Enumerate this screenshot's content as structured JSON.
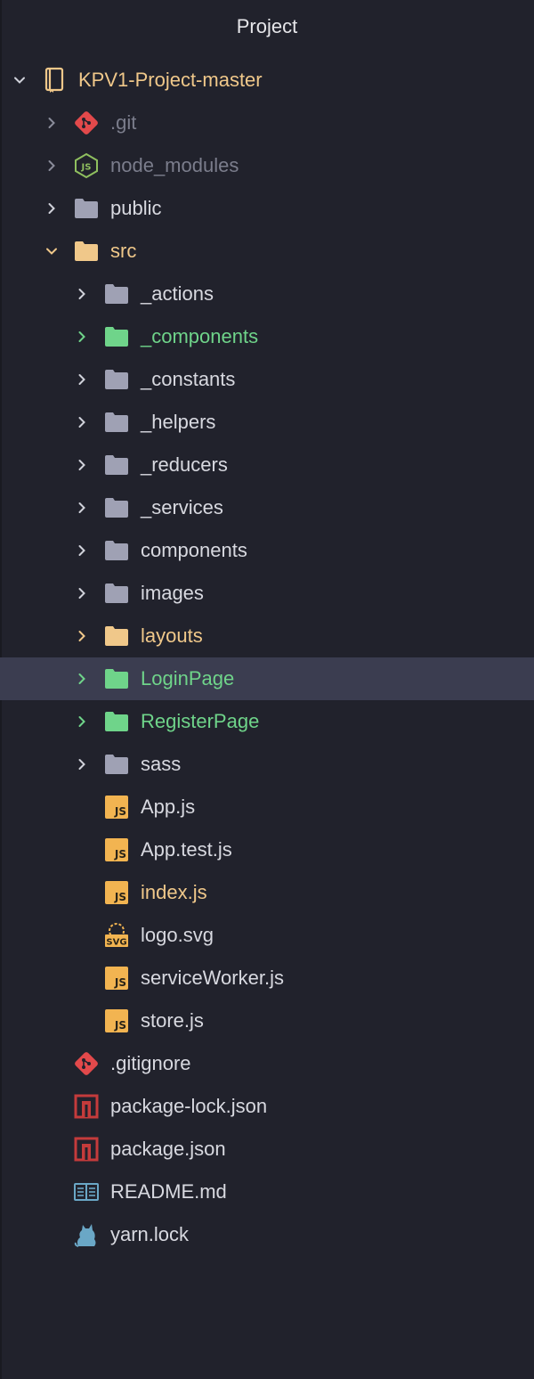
{
  "panel": {
    "title": "Project"
  },
  "tree": {
    "root": {
      "label": "KPV1-Project-master"
    },
    "git": {
      "label": ".git"
    },
    "node_modules": {
      "label": "node_modules"
    },
    "public": {
      "label": "public"
    },
    "src": {
      "label": "src",
      "children": {
        "actions": "_actions",
        "components_u": "_components",
        "constants": "_constants",
        "helpers": "_helpers",
        "reducers": "_reducers",
        "services": "_services",
        "components": "components",
        "images": "images",
        "layouts": "layouts",
        "loginpage": "LoginPage",
        "registerpage": "RegisterPage",
        "sass": "sass",
        "app_js": "App.js",
        "app_test_js": "App.test.js",
        "index_js": "index.js",
        "logo_svg": "logo.svg",
        "service_worker_js": "serviceWorker.js",
        "store_js": "store.js"
      }
    },
    "gitignore": {
      "label": ".gitignore"
    },
    "package_lock": {
      "label": "package-lock.json"
    },
    "package_json": {
      "label": "package.json"
    },
    "readme": {
      "label": "README.md"
    },
    "yarn_lock": {
      "label": "yarn.lock"
    }
  },
  "colors": {
    "background": "#21222c",
    "selected_row": "#3b3d50",
    "folder_default": "#9fa1b4",
    "folder_green": "#6fd48a",
    "folder_yellow": "#f0c88a",
    "git_red": "#e2494b",
    "node_green": "#8fbf5f",
    "js_yellow": "#f2b451",
    "npm_red": "#c43b3b",
    "readme_blue": "#6aa7c6",
    "yarn_blue": "#6aa7c6"
  }
}
